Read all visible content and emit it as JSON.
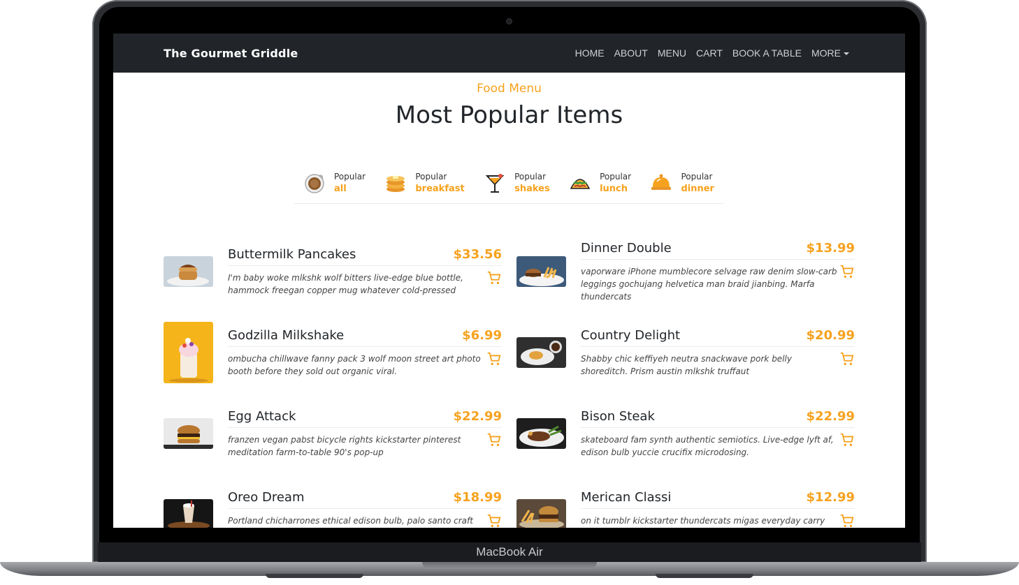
{
  "device": {
    "label": "MacBook Air"
  },
  "navbar": {
    "brand": "The Gourmet Griddle",
    "links": [
      "HOME",
      "ABOUT",
      "MENU",
      "CART",
      "BOOK A TABLE",
      "MORE"
    ]
  },
  "header": {
    "subtitle": "Food Menu",
    "title": "Most Popular Items"
  },
  "tabs": [
    {
      "small": "Popular",
      "strong": "all",
      "icon": "coffee-cup-icon"
    },
    {
      "small": "Popular",
      "strong": "breakfast",
      "icon": "pancakes-icon"
    },
    {
      "small": "Popular",
      "strong": "shakes",
      "icon": "cocktail-icon"
    },
    {
      "small": "Popular",
      "strong": "lunch",
      "icon": "taco-icon"
    },
    {
      "small": "Popular",
      "strong": "dinner",
      "icon": "cloche-icon"
    }
  ],
  "items": [
    {
      "name": "Buttermilk Pancakes",
      "price": "$33.56",
      "desc": "I'm baby woke mlkshk wolf bitters live-edge blue bottle, hammock freegan copper mug whatever cold-pressed"
    },
    {
      "name": "Dinner Double",
      "price": "$13.99",
      "desc": "vaporware iPhone mumblecore selvage raw denim slow-carb leggings gochujang helvetica man braid jianbing. Marfa thundercats"
    },
    {
      "name": "Godzilla Milkshake",
      "price": "$6.99",
      "desc": "ombucha chillwave fanny pack 3 wolf moon street art photo booth before they sold out organic viral."
    },
    {
      "name": "Country Delight",
      "price": "$20.99",
      "desc": "Shabby chic keffiyeh neutra snackwave pork belly shoreditch. Prism austin mlkshk truffaut"
    },
    {
      "name": "Egg Attack",
      "price": "$22.99",
      "desc": "franzen vegan pabst bicycle rights kickstarter pinterest meditation farm-to-table 90's pop-up"
    },
    {
      "name": "Bison Steak",
      "price": "$22.99",
      "desc": "skateboard fam synth authentic semiotics. Live-edge lyft af, edison bulb yuccie crucifix microdosing."
    },
    {
      "name": "Oreo Dream",
      "price": "$18.99",
      "desc": "Portland chicharrones ethical edison bulb, palo santo craft beer chia heirloom iPhone everyday"
    },
    {
      "name": "Merican Classi",
      "price": "$12.99",
      "desc": "on it tumblr kickstarter thundercats migas everyday carry squid palo santo leggings. Food truck truffaut"
    }
  ],
  "colors": {
    "accent": "#f6a21e",
    "navbar": "#212529"
  }
}
